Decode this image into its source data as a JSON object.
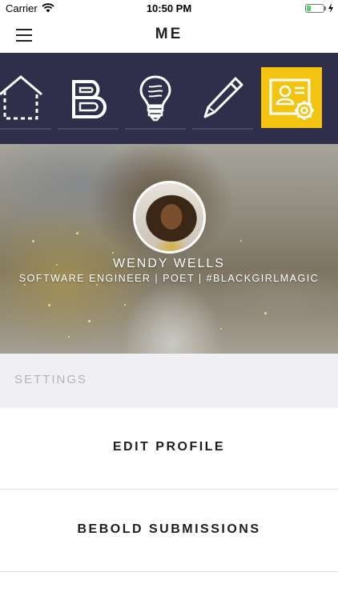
{
  "status_bar": {
    "carrier": "Carrier",
    "time": "10:50 PM",
    "battery_level": 0.25,
    "battery_color": "#4cd964"
  },
  "nav": {
    "title": "ME",
    "menu_icon": "hamburger-menu-icon"
  },
  "toolbar": {
    "background": "#2f2f4c",
    "active_color": "#f2c40f",
    "items": [
      {
        "icon": "home-icon",
        "active": false
      },
      {
        "icon": "bebold-b-icon",
        "active": false
      },
      {
        "icon": "lightbulb-icon",
        "active": false
      },
      {
        "icon": "pen-icon",
        "active": false
      },
      {
        "icon": "profile-settings-icon",
        "active": true
      }
    ]
  },
  "profile": {
    "name": "WENDY WELLS",
    "bio": "SOFTWARE ENGINEER | POET | #BLACKGIRLMAGIC"
  },
  "settings": {
    "header": "SETTINGS",
    "items": [
      {
        "label": "EDIT PROFILE"
      },
      {
        "label": "BEBOLD SUBMISSIONS"
      }
    ]
  }
}
